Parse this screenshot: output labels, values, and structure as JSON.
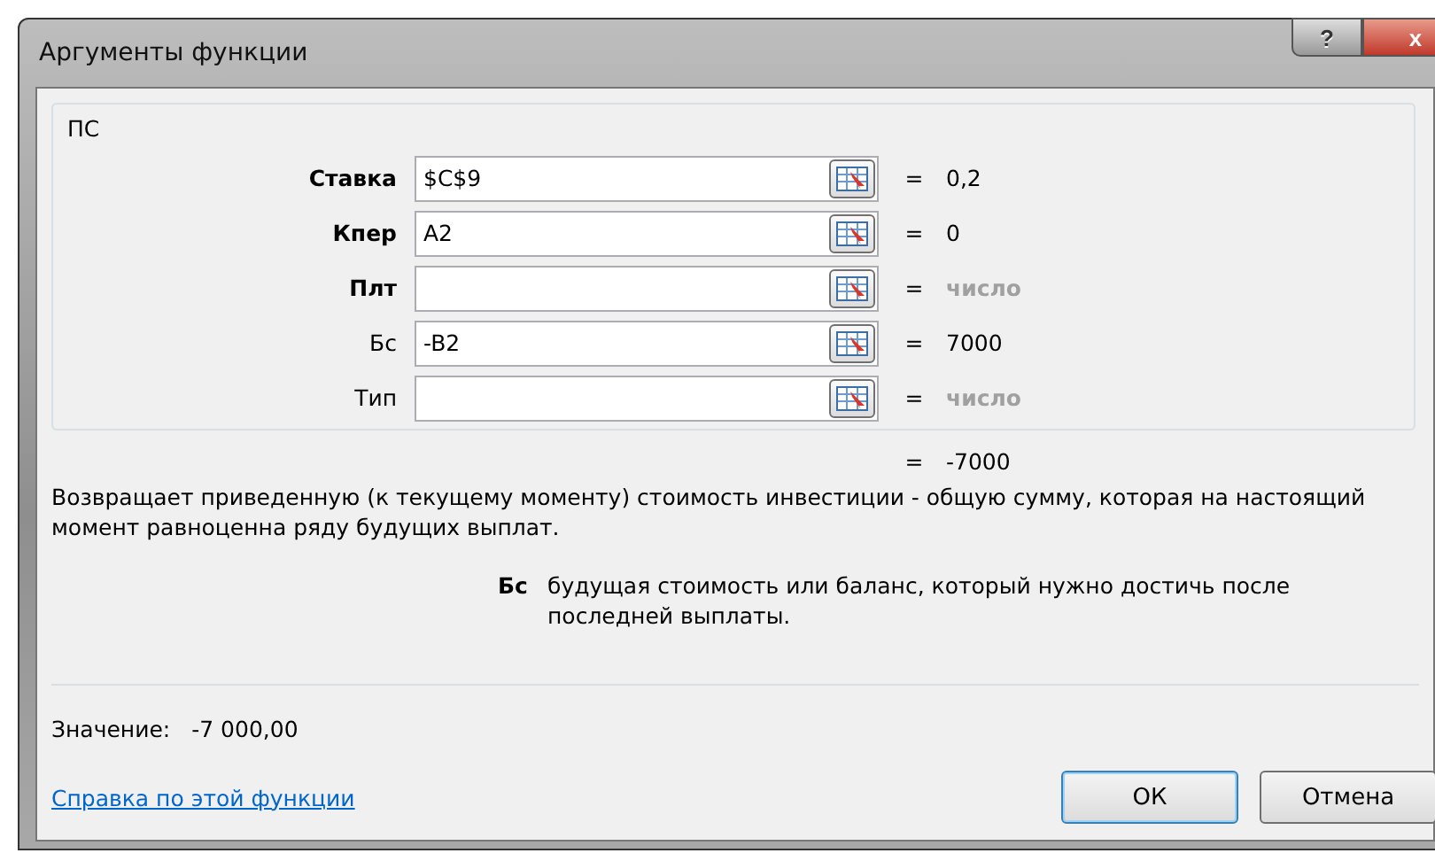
{
  "window": {
    "title": "Аргументы функции",
    "help_button": "?",
    "close_button": "x"
  },
  "function_name": "ПС",
  "arguments": [
    {
      "label": "Ставка",
      "required": true,
      "value": "$C$9",
      "result": "0,2",
      "result_muted": false
    },
    {
      "label": "Кпер",
      "required": true,
      "value": "A2",
      "result": "0",
      "result_muted": false
    },
    {
      "label": "Плт",
      "required": true,
      "result": "число",
      "result_muted": true
    },
    {
      "label": "Бс",
      "required": false,
      "value": "-B2",
      "result": "7000",
      "result_muted": false
    },
    {
      "label": "Тип",
      "required": false,
      "result": "число",
      "result_muted": true
    }
  ],
  "equals": "=",
  "formula_result": "-7000",
  "description": "Возвращает приведенную (к текущему моменту) стоимость инвестиции - общую сумму, которая на настоящий момент равноценна ряду будущих выплат.",
  "argument_help": {
    "name": "Бс",
    "text": "будущая стоимость или баланс, который нужно достичь после последней выплаты."
  },
  "value_label": "Значение:",
  "value": "-7 000,00",
  "help_link": "Справка по этой функции",
  "buttons": [
    {
      "label": "ОК",
      "selected": true
    },
    {
      "label": "Отмена",
      "selected": false
    }
  ]
}
